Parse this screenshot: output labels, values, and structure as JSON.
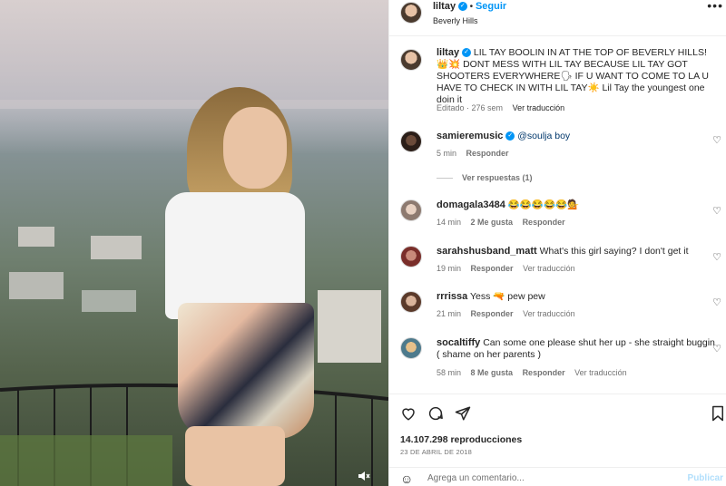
{
  "post": {
    "username": "liltay",
    "follow_label": "Seguir",
    "location": "Beverly Hills",
    "caption": "LIL TAY BOOLIN IN AT THE TOP OF BEVERLY HILLS! 👑💥 DONT MESS WITH LIL TAY BECAUSE LIL TAY GOT SHOOTERS EVERYWHERE🗣 IF U WANT TO COME TO LA U HAVE TO CHECK IN WITH LIL TAY☀️ Lil Tay the youngest one doin it",
    "edited": "Editado · 276 sem",
    "see_translation": "Ver traducción",
    "views": "14.107.298 reproducciones",
    "date": "23 DE ABRIL DE 2018"
  },
  "comments": [
    {
      "user": "samieremusic",
      "verified": true,
      "text": "@soulja boy",
      "time": "5 min",
      "likes": "",
      "actions": [
        "Responder"
      ],
      "replies": "Ver respuestas (1)"
    },
    {
      "user": "domagala3484",
      "verified": false,
      "text": "😂😂😂😂😂💁",
      "time": "14 min",
      "likes": "2 Me gusta",
      "actions": [
        "Responder"
      ],
      "replies": ""
    },
    {
      "user": "sarahshusband_matt",
      "verified": false,
      "text": "What's this girl saying? I don't get it",
      "time": "19 min",
      "likes": "",
      "actions": [
        "Responder",
        "Ver traducción"
      ],
      "replies": ""
    },
    {
      "user": "rrrissa",
      "verified": false,
      "text": "Yess 🔫 pew pew",
      "time": "21 min",
      "likes": "",
      "actions": [
        "Responder",
        "Ver traducción"
      ],
      "replies": ""
    },
    {
      "user": "socaltiffy",
      "verified": false,
      "text": "Can some one please shut her up - she straight buggin ( shame on her parents )",
      "time": "58 min",
      "likes": "8 Me gusta",
      "actions": [
        "Responder",
        "Ver traducción"
      ],
      "replies": ""
    }
  ],
  "add_comment": {
    "placeholder": "Agrega un comentario...",
    "post_label": "Publicar"
  },
  "colors": {
    "accent": "#0095f6",
    "muted": "#737373",
    "text": "#262626"
  }
}
